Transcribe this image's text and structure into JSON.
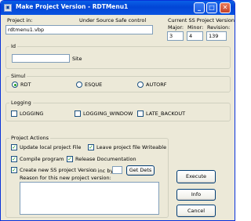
{
  "window": {
    "title": "Make Project Version - RDTMenu1",
    "minimize": "_",
    "maximize": "□",
    "close": "✕"
  },
  "project": {
    "label": "Project in:",
    "status": "Under Source Safe control",
    "file": "rdtmenu1.vbp"
  },
  "ss_version": {
    "title": "Current SS Project Version",
    "major_label": "Major:",
    "minor_label": "Minor:",
    "revision_label": "Revision:",
    "major": "3",
    "minor": "4",
    "revision": "139"
  },
  "id_group": {
    "title": "Id",
    "value": "",
    "suffix": "Site"
  },
  "simul": {
    "title": "Simul",
    "options": [
      "RDT",
      "ESQUE",
      "AUTORF"
    ],
    "selected": "RDT"
  },
  "logging": {
    "title": "Logging",
    "options": [
      "LOGGING",
      "LOGGING_WINDOW",
      "LATE_BACKOUT"
    ]
  },
  "actions": {
    "title": "Project Actions",
    "update_local": "Update local project File",
    "leave_writeable": "Leave project file Writeable",
    "compile": "Compile program",
    "release_doc": "Release Documentation",
    "create_version": "Create new SS project Version",
    "inc_by": "-- inc by:",
    "inc_value": "",
    "get_dets": "Get Dets",
    "reason_label": "Reason for this new project version:",
    "reason": ""
  },
  "buttons": {
    "execute": "Execute",
    "info": "Info",
    "cancel": "Cancel"
  }
}
